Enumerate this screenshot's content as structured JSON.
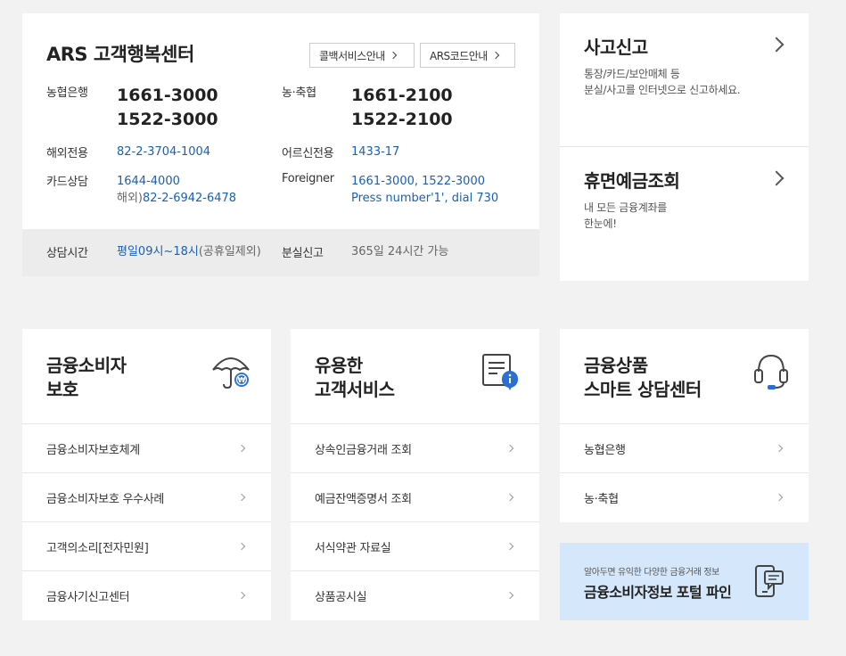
{
  "ars": {
    "title": "ARS 고객행복센터",
    "callback_btn": "콜백서비스안내",
    "arscode_btn": "ARS코드안내",
    "nh_bank_label": "농협은행",
    "nh_bank_num1": "1661-3000",
    "nh_bank_num2": "1522-3000",
    "coop_label": "농·축협",
    "coop_num1": "1661-2100",
    "coop_num2": "1522-2100",
    "overseas_label": "해외전용",
    "overseas_num": "82-2-3704-1004",
    "senior_label": "어르신전용",
    "senior_num": "1433-17",
    "card_label": "카드상담",
    "card_num": "1644-4000",
    "card_overseas_prefix": "해외)",
    "card_overseas_num": "82-2-6942-6478",
    "foreigner_label": "Foreigner",
    "foreigner_num": "1661-3000, 1522-3000",
    "foreigner_note": "Press number'1', dial 730",
    "hours_label": "상담시간",
    "hours_value": "평일09시~18시",
    "hours_note": "(공휴일제외)",
    "lost_label": "분실신고",
    "lost_value": "365일 24시간 가능"
  },
  "accident": {
    "title": "사고신고",
    "desc1": "통장/카드/보안매체 등",
    "desc2": "분실/사고를 인터넷으로 신고하세요."
  },
  "dormant": {
    "title": "휴면예금조회",
    "desc1": "내 모든 금융계좌를",
    "desc2": "한눈에!"
  },
  "consumer": {
    "title1": "금융소비자",
    "title2": "보호",
    "items": [
      "금융소비자보호체계",
      "금융소비자보호 우수사례",
      "고객의소리[전자민원]",
      "금융사기신고센터"
    ]
  },
  "service": {
    "title1": "유용한",
    "title2": "고객서비스",
    "items": [
      "상속인금융거래 조회",
      "예금잔액증명서 조회",
      "서식약관 자료실",
      "상품공시실"
    ]
  },
  "smart": {
    "title1": "금융상품",
    "title2": "스마트 상담센터",
    "items": [
      "농협은행",
      "농·축협"
    ]
  },
  "portal": {
    "small": "알아두면 유익한 다양한 금융거래 정보",
    "title": "금융소비자정보 포털 파인"
  },
  "colors": {
    "accent": "#1a5fb4",
    "portal_bg": "#d5e8fb",
    "icon_blue": "#2a6fd1"
  }
}
